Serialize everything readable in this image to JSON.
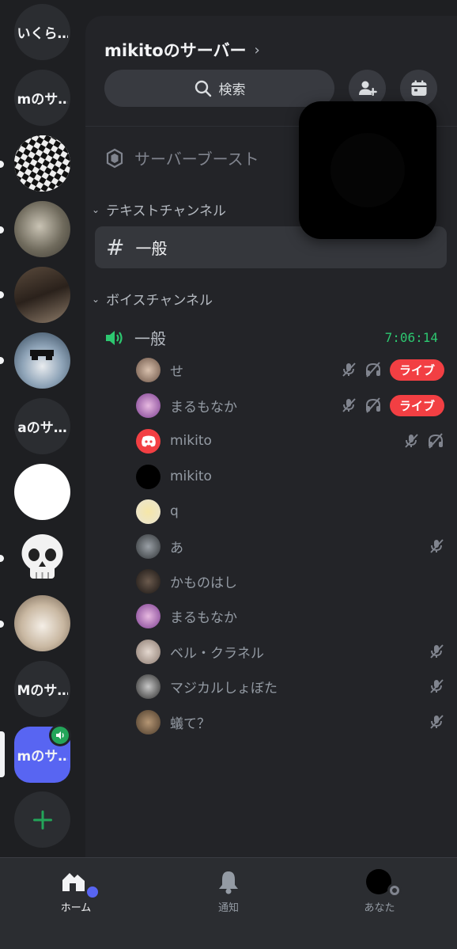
{
  "servers": [
    {
      "label": "いくら…",
      "type": "text"
    },
    {
      "label": "mのサ…",
      "type": "text"
    },
    {
      "label": "",
      "type": "image",
      "desc": "checker"
    },
    {
      "label": "",
      "type": "image",
      "desc": "photo"
    },
    {
      "label": "",
      "type": "image",
      "desc": "photo"
    },
    {
      "label": "",
      "type": "image",
      "desc": "anime"
    },
    {
      "label": "aのサ…",
      "type": "text"
    },
    {
      "label": "",
      "type": "image",
      "desc": "white"
    },
    {
      "label": "",
      "type": "image",
      "desc": "skull"
    },
    {
      "label": "",
      "type": "image",
      "desc": "cat"
    },
    {
      "label": "Mのサ…",
      "type": "text"
    },
    {
      "label": "mのサ…",
      "type": "active"
    }
  ],
  "header": {
    "server_name": "mikitoのサーバー",
    "chevron": "›",
    "search_label": "検索"
  },
  "boost_label": "サーバーブースト",
  "categories": {
    "text": "テキストチャンネル",
    "voice": "ボイスチャンネル"
  },
  "text_channel": {
    "name": "一般"
  },
  "voice_channel": {
    "name": "一般",
    "timer": "7:06:14"
  },
  "members": [
    {
      "name": "せ",
      "live": true,
      "muted": true,
      "deafened": true
    },
    {
      "name": "まるもなか",
      "live": true,
      "muted": true,
      "deafened": true
    },
    {
      "name": "mikito",
      "live": false,
      "muted": true,
      "deafened": true
    },
    {
      "name": "mikito",
      "live": false,
      "muted": false,
      "deafened": false
    },
    {
      "name": "q",
      "live": false,
      "muted": false,
      "deafened": false
    },
    {
      "name": "あ",
      "live": false,
      "muted": true,
      "deafened": false
    },
    {
      "name": "かものはし",
      "live": false,
      "muted": false,
      "deafened": false
    },
    {
      "name": "まるもなか",
      "live": false,
      "muted": false,
      "deafened": false
    },
    {
      "name": "ベル・クラネル",
      "live": false,
      "muted": true,
      "deafened": false
    },
    {
      "name": "マジカルしょぼた",
      "live": false,
      "muted": true,
      "deafened": false
    },
    {
      "name": "蟻て？",
      "live": false,
      "muted": true,
      "deafened": false
    }
  ],
  "live_label": "ライブ",
  "nav": {
    "home": "ホーム",
    "notifications": "通知",
    "you": "あなた"
  },
  "colors": {
    "accent": "#5865f2",
    "live": "#f23f43",
    "voice_green": "#2dc770"
  }
}
